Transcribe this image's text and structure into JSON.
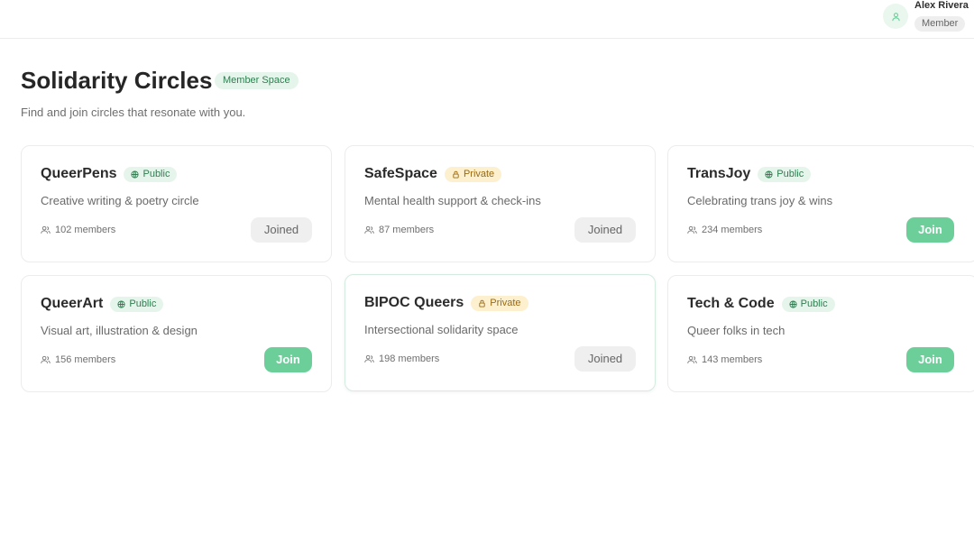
{
  "user": {
    "name": "Alex Rivera",
    "role": "Member"
  },
  "header": {
    "title": "Solidarity Circles",
    "badge": "Member Space",
    "subtitle": "Find and join circles that resonate with you."
  },
  "circles": [
    {
      "name": "QueerPens",
      "visibility": "Public",
      "description": "Creative writing & poetry circle",
      "members": "102 members",
      "action": "Joined"
    },
    {
      "name": "SafeSpace",
      "visibility": "Private",
      "description": "Mental health support & check-ins",
      "members": "87 members",
      "action": "Joined"
    },
    {
      "name": "TransJoy",
      "visibility": "Public",
      "description": "Celebrating trans joy & wins",
      "members": "234 members",
      "action": "Join"
    },
    {
      "name": "QueerArt",
      "visibility": "Public",
      "description": "Visual art, illustration & design",
      "members": "156 members",
      "action": "Join"
    },
    {
      "name": "BIPOC Queers",
      "visibility": "Private",
      "description": "Intersectional solidarity space",
      "members": "198 members",
      "action": "Joined"
    },
    {
      "name": "Tech & Code",
      "visibility": "Public",
      "description": "Queer folks in tech",
      "members": "143 members",
      "action": "Join"
    }
  ],
  "icons": {
    "avatar": "user-icon",
    "public": "globe-icon",
    "private": "lock-icon",
    "members": "users-icon"
  },
  "colors": {
    "accent": "#6ccf9a",
    "public_bg": "#e6f5ec",
    "private_bg": "#fdf0cf"
  }
}
